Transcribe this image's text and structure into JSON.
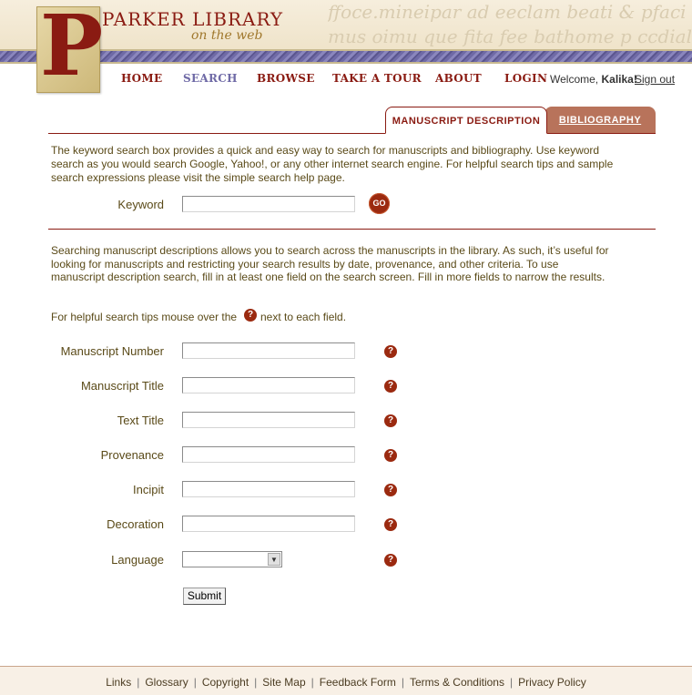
{
  "header": {
    "title": "PARKER LIBRARY",
    "subtitle": "on the web",
    "logo_letter": "P",
    "script_line1": "ffoce.mineipar ad eeclam beati & pfaci eccle",
    "script_line2": "mus oimu que fita fee bathome p ccdiale"
  },
  "nav": {
    "items": [
      "HOME",
      "SEARCH",
      "BROWSE",
      "TAKE A TOUR",
      "ABOUT",
      "LOGIN"
    ],
    "active": "SEARCH",
    "welcome_prefix": "Welcome,",
    "user": "Kalika!",
    "signout": "Sign out"
  },
  "tabs": {
    "desc": "MANUSCRIPT DESCRIPTION",
    "bib": "BIBLIOGRAPHY"
  },
  "keyword": {
    "intro": "The keyword search box provides a quick and easy way to search for manuscripts and bibliography. Use keyword search as you would search Google, Yahoo!, or any other internet search engine. For helpful search tips and sample search expressions please visit the simple search help page.",
    "label": "Keyword",
    "value": "",
    "go": "GO"
  },
  "advanced": {
    "intro": "Searching manuscript descriptions allows you to search across the manuscripts in the library. As such, it’s useful for looking for manuscripts and restricting your search results by date, provenance, and other criteria. To use manuscript description search, fill in at least one field on the search screen. Fill in more fields to narrow the results.",
    "tips_before": "For helpful search tips mouse over the",
    "tips_after": "next to each field.",
    "help_glyph": "?",
    "fields": [
      {
        "label": "Manuscript Number",
        "value": ""
      },
      {
        "label": "Manuscript Title",
        "value": ""
      },
      {
        "label": "Text Title",
        "value": ""
      },
      {
        "label": "Provenance",
        "value": ""
      },
      {
        "label": "Incipit",
        "value": ""
      },
      {
        "label": "Decoration",
        "value": ""
      }
    ],
    "language_label": "Language",
    "language_value": "",
    "submit": "Submit"
  },
  "footer": {
    "links": [
      "Links",
      "Glossary",
      "Copyright",
      "Site Map",
      "Feedback Form",
      "Terms & Conditions",
      "Privacy Policy"
    ]
  },
  "colors": {
    "accent": "#8a1b12",
    "active_nav": "#6f6aa6",
    "text": "#5a4a18",
    "tab_inactive": "#b8735b"
  }
}
